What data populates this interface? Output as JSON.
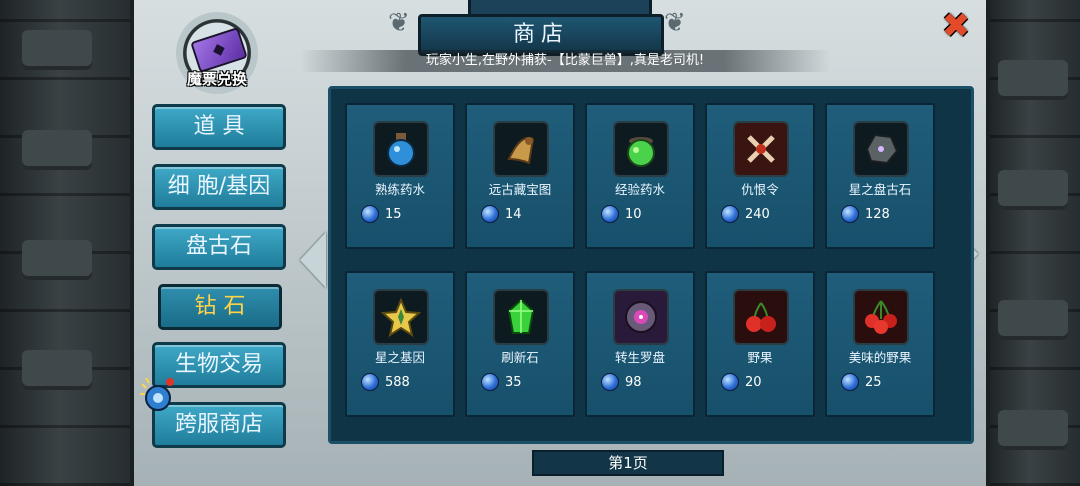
{
  "header": {
    "title": "商店",
    "announcement": "玩家小生,在野外捕获-【比蒙巨兽】,真是老司机!"
  },
  "ticket": {
    "label": "魔票兑换",
    "icon": "magic-ticket-icon"
  },
  "close": {
    "icon": "close-icon",
    "color": "#e24a2a"
  },
  "categories": [
    {
      "label": "道 具",
      "active": false
    },
    {
      "label": "细 胞/基因",
      "active": false
    },
    {
      "label": "盘古石",
      "active": false
    },
    {
      "label": "钻 石",
      "active": true
    },
    {
      "label": "生物交易",
      "active": false
    },
    {
      "label": "跨服商店",
      "active": false
    }
  ],
  "currency": {
    "icon": "blue-gem-icon"
  },
  "items": [
    {
      "name": "熟练药水",
      "price": "15",
      "icon": "blue-potion-icon"
    },
    {
      "name": "远古藏宝图",
      "price": "14",
      "icon": "treasure-map-icon"
    },
    {
      "name": "经验药水",
      "price": "10",
      "icon": "green-cauldron-icon"
    },
    {
      "name": "仇恨令",
      "price": "240",
      "icon": "crossed-swords-icon"
    },
    {
      "name": "星之盘古石",
      "price": "128",
      "icon": "star-stone-icon"
    },
    {
      "name": "星之基因",
      "price": "588",
      "icon": "gold-star-icon"
    },
    {
      "name": "刷新石",
      "price": "35",
      "icon": "green-crystal-icon"
    },
    {
      "name": "转生罗盘",
      "price": "98",
      "icon": "rebirth-compass-icon"
    },
    {
      "name": "野果",
      "price": "20",
      "icon": "cherry-icon"
    },
    {
      "name": "美味的野果",
      "price": "25",
      "icon": "cherry-bunch-icon"
    }
  ],
  "pagination": {
    "label": "第1页"
  },
  "colors": {
    "accent": "#ffd34a",
    "panel": "#0f3446",
    "tile": "#1f5d7a"
  }
}
